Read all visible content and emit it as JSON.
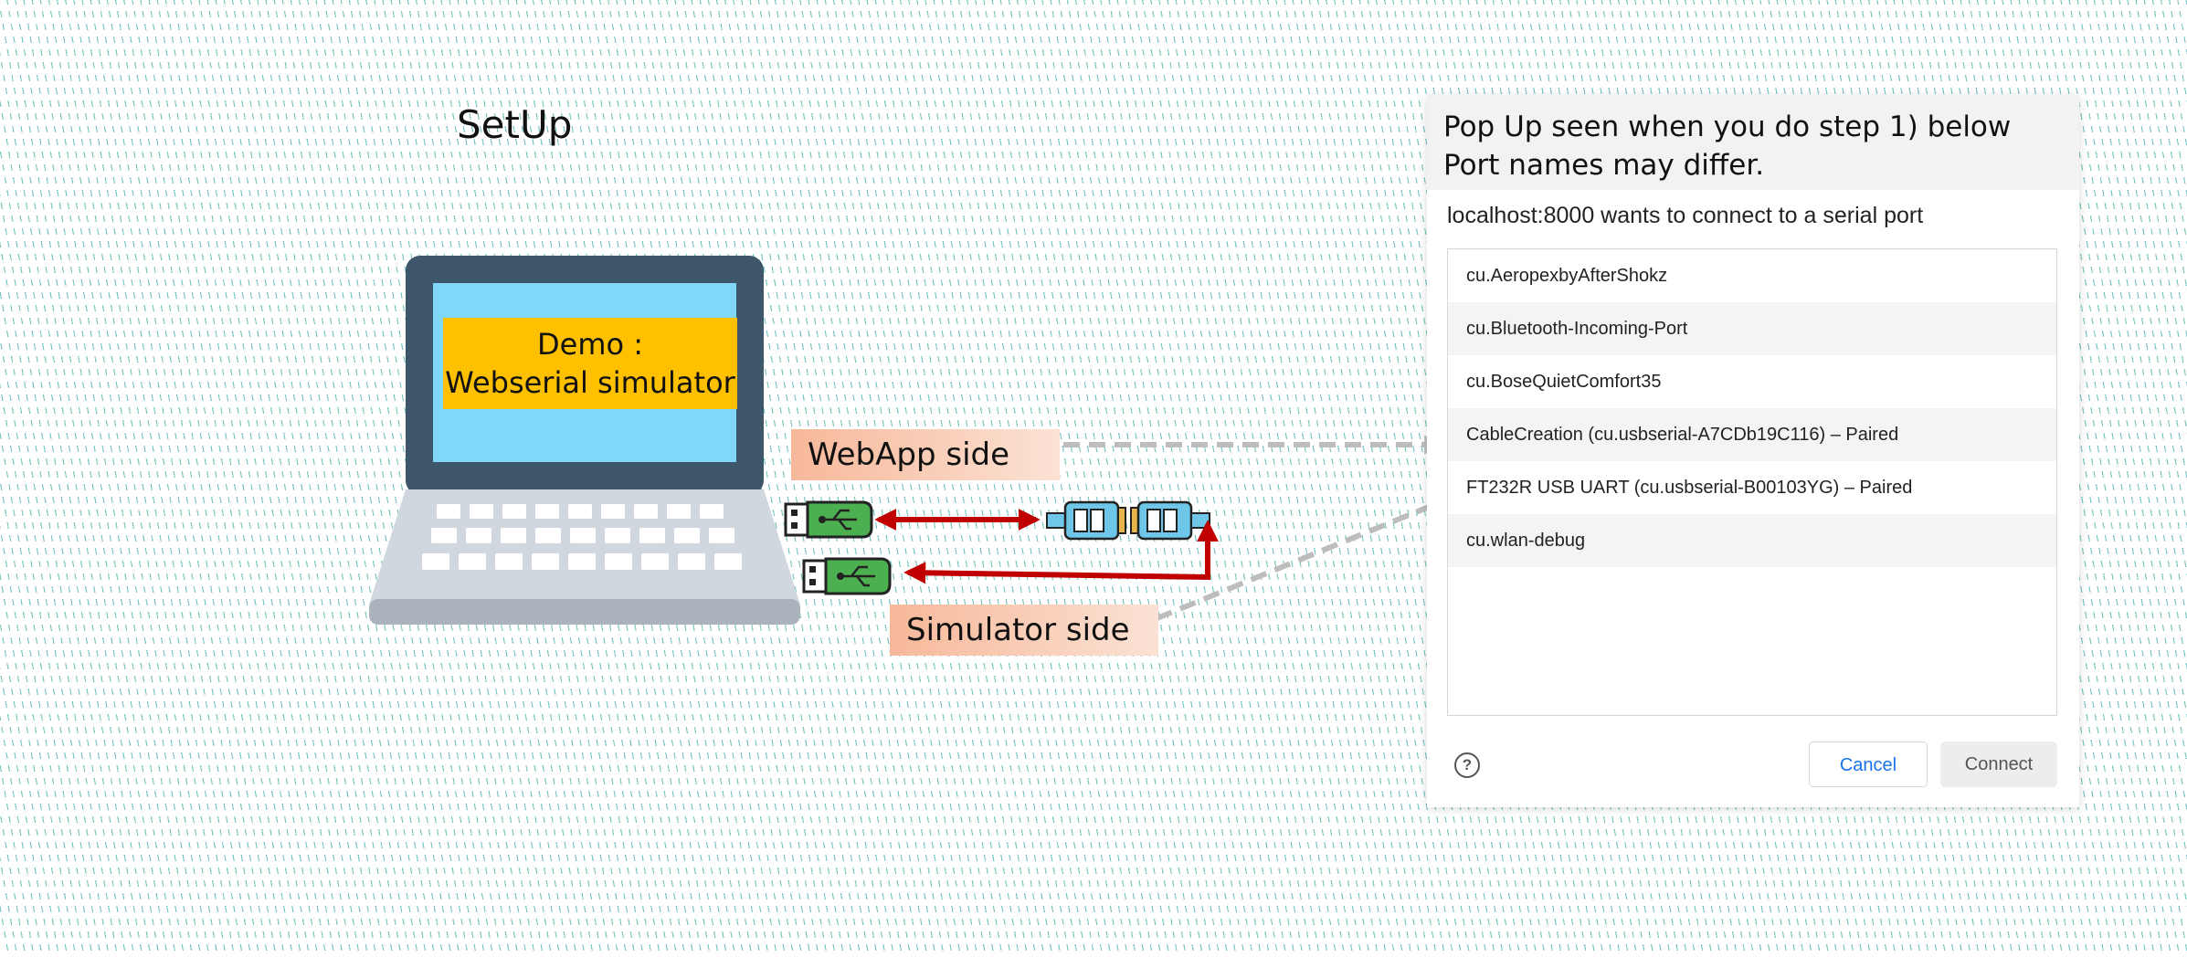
{
  "setup": {
    "title": "SetUp"
  },
  "laptop": {
    "screen_line1": "Demo :",
    "screen_line2": "Webserial simulator"
  },
  "labels": {
    "webapp": "WebApp side",
    "simulator": "Simulator side"
  },
  "popup": {
    "header_line1": "Pop Up seen when you do step 1) below",
    "header_line2": "Port names may differ.",
    "prompt": "localhost:8000 wants to connect to a serial port",
    "ports": [
      "cu.AeropexbyAfterShokz",
      "cu.Bluetooth-Incoming-Port",
      "cu.BoseQuietComfort35",
      "CableCreation (cu.usbserial-A7CDb19C116) – Paired",
      "FT232R USB UART (cu.usbserial-B00103YG) – Paired",
      "cu.wlan-debug"
    ],
    "help_icon": "question-circle-icon",
    "cancel_label": "Cancel",
    "connect_label": "Connect"
  },
  "icons": [
    "laptop-icon",
    "usb-drive-icon",
    "serial-connector-icon"
  ],
  "colors": {
    "label_bg": "#f7b89a",
    "screen_label_bg": "#ffc000",
    "laptop_screen": "#7fd8f8",
    "laptop_bezel": "#3e566a",
    "usb_green": "#4caf50",
    "cable_red": "#c00000",
    "dashed_gray": "#bdbdbd",
    "link_blue": "#1a73e8"
  }
}
